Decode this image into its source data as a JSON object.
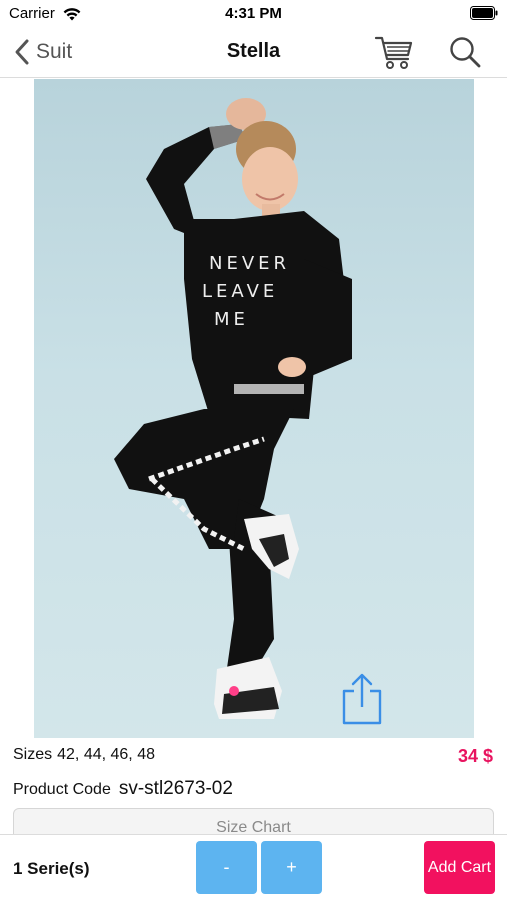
{
  "status_bar": {
    "carrier": "Carrier",
    "time": "4:31 PM"
  },
  "nav": {
    "back_label": "Suit",
    "title": "Stella",
    "cart_icon": "cart-icon",
    "search_icon": "search-icon"
  },
  "product": {
    "image_description_icon": "product-photo",
    "share_icon": "share-icon",
    "sizes_label": "Sizes",
    "sizes_value": "42, 44, 46, 48",
    "price": "34 $",
    "code_label": "Product Code",
    "code_value": "sv-stl2673-02",
    "size_chart_label": "Size Chart"
  },
  "bottom_bar": {
    "series_count": "1 Serie(s)",
    "minus_label": "-",
    "plus_label": "+",
    "add_cart_label": "Add Cart"
  },
  "colors": {
    "accent_pink": "#f2115f",
    "price_pink": "#e8135f",
    "button_blue": "#5db4f0",
    "share_blue": "#3a8ee6"
  }
}
